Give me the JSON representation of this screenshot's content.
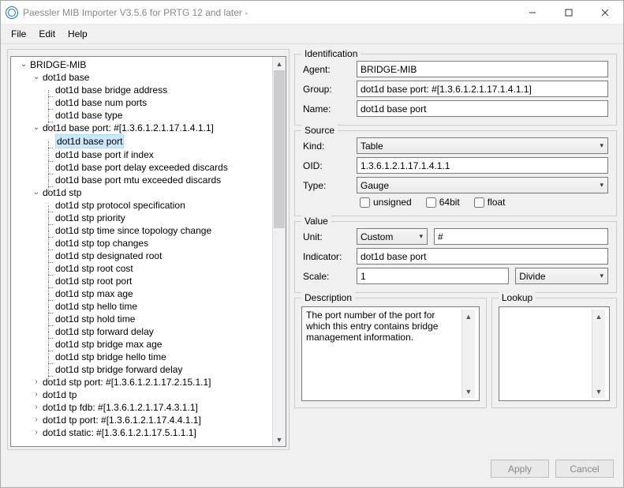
{
  "window": {
    "title": "Paessler MIB Importer V3.5.6 for PRTG 12 and later -"
  },
  "menu": {
    "file": "File",
    "edit": "Edit",
    "help": "Help"
  },
  "tree": {
    "root": "BRIDGE-MIB",
    "base": {
      "label": "dot1d base",
      "children": [
        "dot1d base bridge address",
        "dot1d base num ports",
        "dot1d base type"
      ]
    },
    "basePort": {
      "label": "dot1d base port: #[1.3.6.1.2.1.17.1.4.1.1]",
      "children": [
        "dot1d base port",
        "dot1d base port if index",
        "dot1d base port delay exceeded discards",
        "dot1d base port mtu exceeded discards"
      ]
    },
    "stp": {
      "label": "dot1d stp",
      "children": [
        "dot1d stp protocol specification",
        "dot1d stp priority",
        "dot1d stp time since topology change",
        "dot1d stp top changes",
        "dot1d stp designated root",
        "dot1d stp root cost",
        "dot1d stp root port",
        "dot1d stp max age",
        "dot1d stp hello time",
        "dot1d stp hold time",
        "dot1d stp forward delay",
        "dot1d stp bridge max age",
        "dot1d stp bridge hello time",
        "dot1d stp bridge forward delay"
      ]
    },
    "collapsed": [
      "dot1d stp port: #[1.3.6.1.2.1.17.2.15.1.1]",
      "dot1d tp",
      "dot1d tp fdb: #[1.3.6.1.2.1.17.4.3.1.1]",
      "dot1d tp port: #[1.3.6.1.2.1.17.4.4.1.1]",
      "dot1d static: #[1.3.6.1.2.1.17.5.1.1.1]"
    ]
  },
  "identification": {
    "legend": "Identification",
    "agentLabel": "Agent:",
    "agent": "BRIDGE-MIB",
    "groupLabel": "Group:",
    "group": "dot1d base port: #[1.3.6.1.2.1.17.1.4.1.1]",
    "nameLabel": "Name:",
    "name": "dot1d base port"
  },
  "source": {
    "legend": "Source",
    "kindLabel": "Kind:",
    "kind": "Table",
    "oidLabel": "OID:",
    "oid": "1.3.6.1.2.1.17.1.4.1.1",
    "typeLabel": "Type:",
    "type": "Gauge",
    "unsigned": "unsigned",
    "sixtyfour": "64bit",
    "float": "float"
  },
  "value": {
    "legend": "Value",
    "unitLabel": "Unit:",
    "unit": "Custom",
    "unitText": "#",
    "indicatorLabel": "Indicator:",
    "indicator": "dot1d base port",
    "scaleLabel": "Scale:",
    "scale": "1",
    "scaleOp": "Divide"
  },
  "description": {
    "legend": "Description",
    "text": "The port number of the port for which this entry contains bridge management information."
  },
  "lookup": {
    "legend": "Lookup"
  },
  "footer": {
    "apply": "Apply",
    "cancel": "Cancel"
  }
}
